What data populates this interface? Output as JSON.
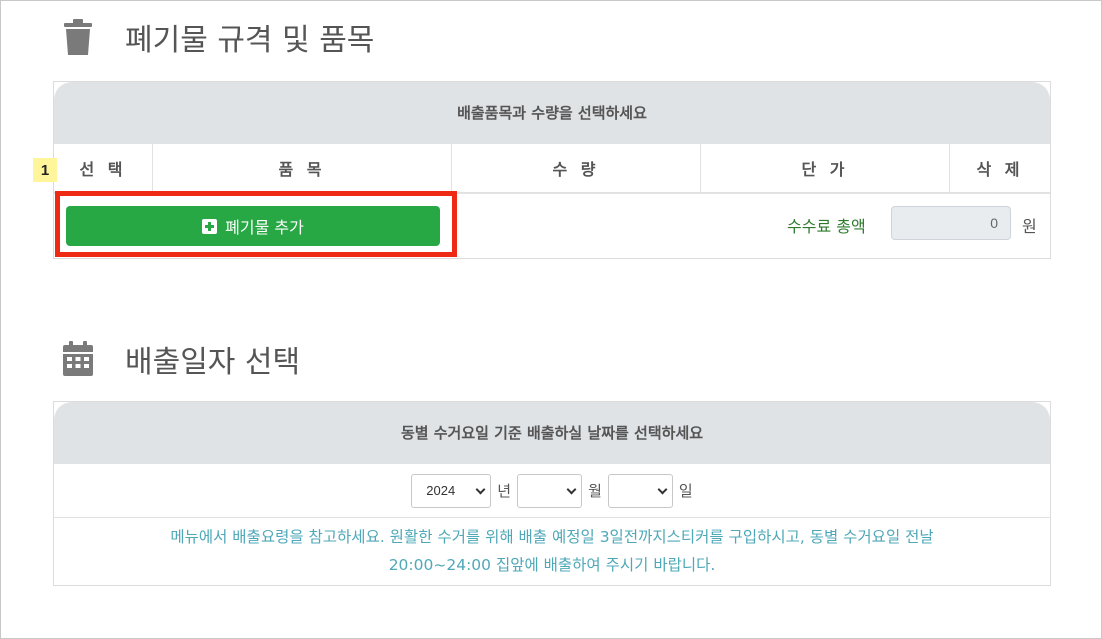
{
  "sections": {
    "waste": {
      "title": "폐기물 규격 및 품목",
      "panel_header": "배출품목과 수량을 선택하세요",
      "columns": [
        "선 택",
        "품 목",
        "수 량",
        "단 가",
        "삭 제"
      ],
      "marker": "1",
      "add_button_label": "폐기물 추가",
      "fee_label": "수수료 총액",
      "fee_value": "0",
      "fee_unit": "원"
    },
    "date": {
      "title": "배출일자 선택",
      "panel_header": "동별 수거요일 기준 배출하실 날짜를 선택하세요",
      "year_value": "2024",
      "year_unit": "년",
      "month_value": "",
      "month_unit": "월",
      "day_value": "",
      "day_unit": "일",
      "notice_line1": "메뉴에서 배출요령을 참고하세요. 원활한 수거를 위해 배출 예정일 3일전까지스티커를 구입하시고, 동별 수거요일 전날",
      "notice_line2": "20:00~24:00 집앞에 배출하여 주시기 바랍니다."
    }
  },
  "icons": {
    "section1": "trash-icon",
    "section2": "calendar-icon",
    "add": "plus-square-icon"
  },
  "colors": {
    "add_button": "#28a745",
    "highlight_frame": "#ef2a14",
    "marker": "#fff59a",
    "notice_text": "#4fa8b8",
    "fee_label": "#2d7a2d"
  }
}
